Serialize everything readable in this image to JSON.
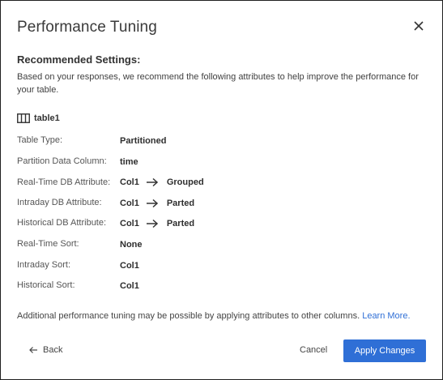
{
  "dialog": {
    "title": "Performance Tuning",
    "close_icon": "close-icon"
  },
  "recommended": {
    "heading": "Recommended Settings:",
    "description": "Based on your responses, we recommend the following attributes to help improve the performance for your table.",
    "table_icon": "table-columns-icon",
    "table_name": "table1"
  },
  "attributes": [
    {
      "label": "Table Type:",
      "value": "Partitioned"
    },
    {
      "label": "Partition Data Column:",
      "value": "time"
    },
    {
      "label": "Real-Time DB Attribute:",
      "value": "Col1",
      "target": "Grouped"
    },
    {
      "label": "Intraday DB Attribute:",
      "value": "Col1",
      "target": "Parted"
    },
    {
      "label": "Historical DB Attribute:",
      "value": "Col1",
      "target": "Parted"
    },
    {
      "label": "Real-Time Sort:",
      "value": "None"
    },
    {
      "label": "Intraday Sort:",
      "value": "Col1"
    },
    {
      "label": "Historical Sort:",
      "value": "Col1"
    }
  ],
  "footer": {
    "note": "Additional performance tuning may be possible by applying attributes to other columns.",
    "learn_more": "Learn More.",
    "back_label": "Back",
    "back_icon": "arrow-left-icon",
    "cancel_label": "Cancel",
    "apply_label": "Apply Changes"
  },
  "colors": {
    "accent": "#2f6fd6",
    "text": "#3c3c3c",
    "border": "#1f1f1f"
  }
}
